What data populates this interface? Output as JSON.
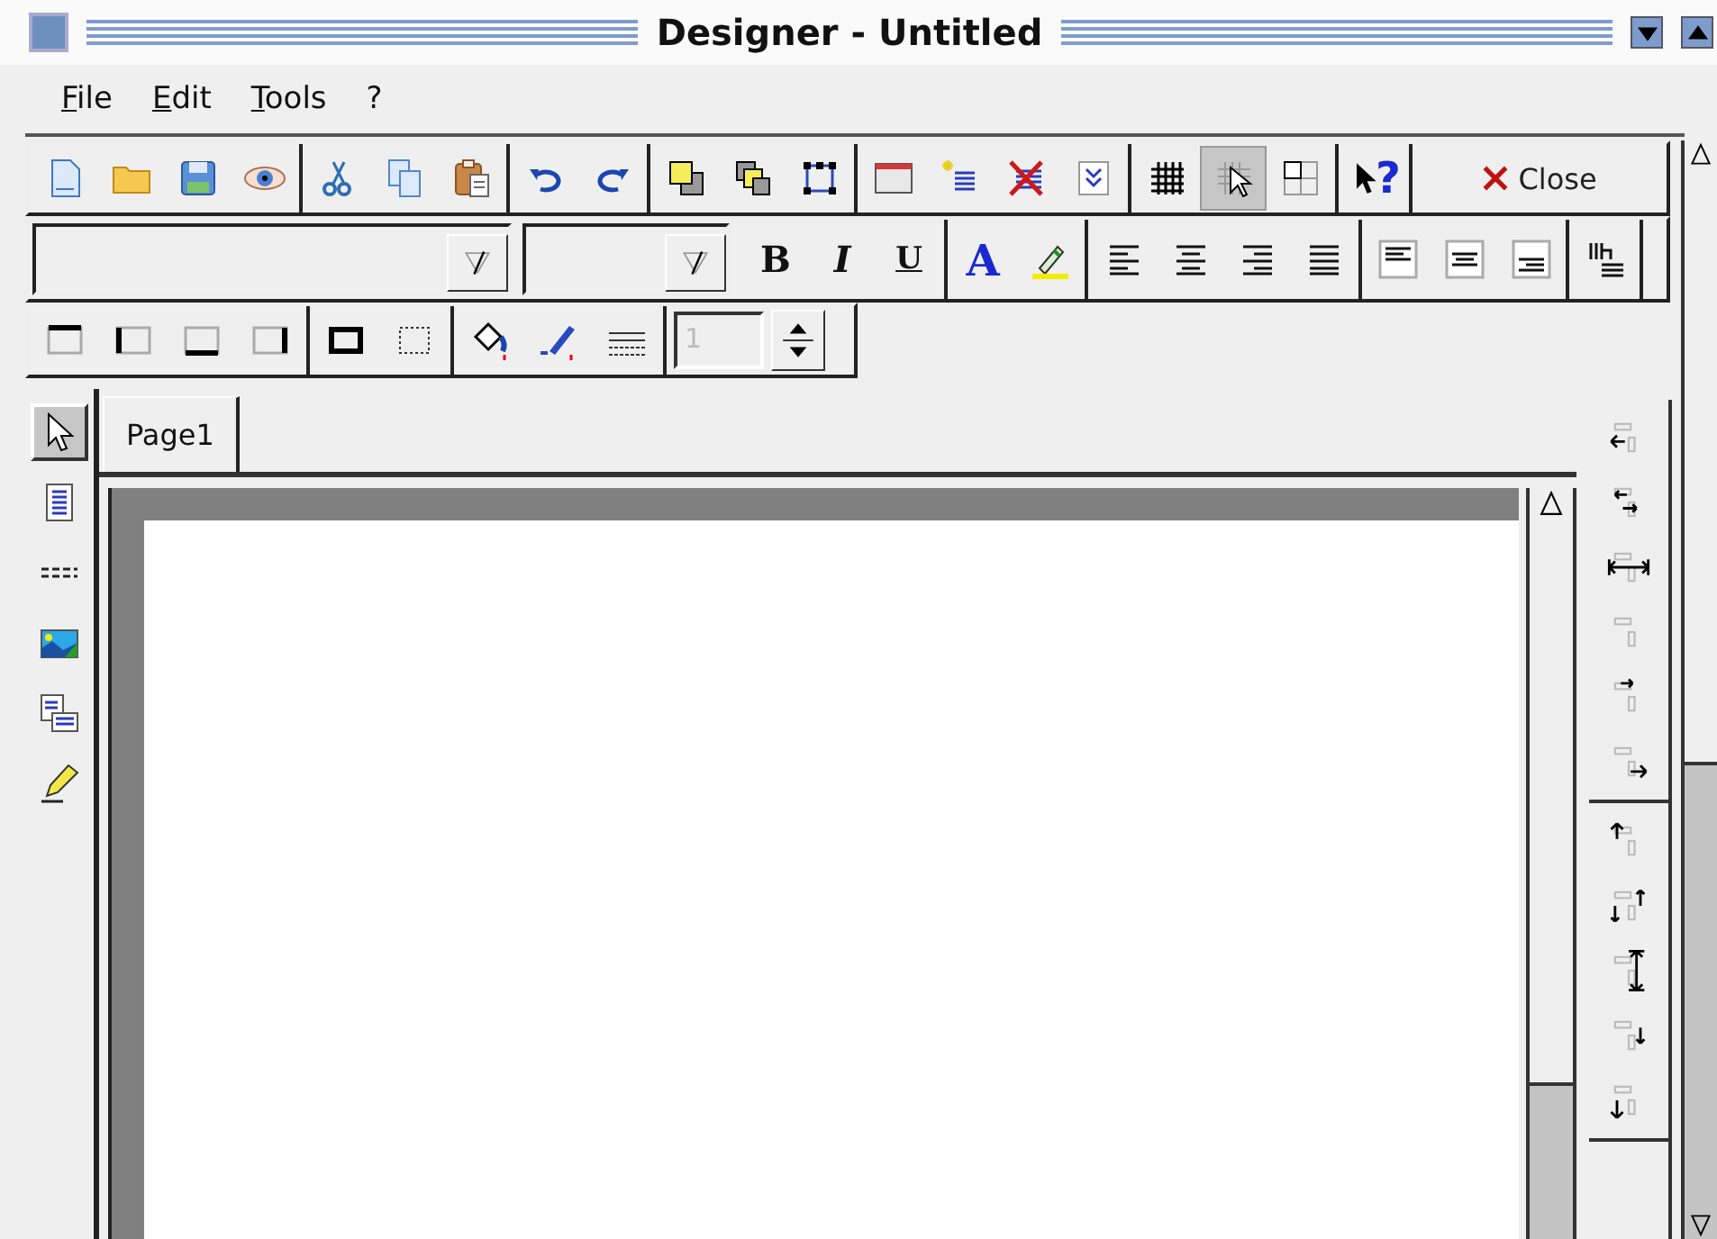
{
  "window": {
    "title": "Designer - Untitled"
  },
  "menu": [
    {
      "label": "File"
    },
    {
      "label": "Edit"
    },
    {
      "label": "Tools"
    },
    {
      "label": "?"
    }
  ],
  "toolbar_main": {
    "groups": [
      [
        {
          "kind": "new"
        },
        {
          "kind": "open"
        },
        {
          "kind": "save"
        },
        {
          "kind": "preview"
        }
      ],
      [
        {
          "kind": "cut"
        },
        {
          "kind": "copy"
        },
        {
          "kind": "paste"
        }
      ],
      [
        {
          "kind": "undo"
        },
        {
          "kind": "redo"
        }
      ],
      [
        {
          "kind": "front"
        },
        {
          "kind": "back"
        },
        {
          "kind": "frame"
        }
      ],
      [
        {
          "kind": "window"
        },
        {
          "kind": "add"
        },
        {
          "kind": "delete"
        },
        {
          "kind": "chevrons"
        }
      ],
      [
        {
          "kind": "grid",
          "pressed": false
        },
        {
          "kind": "snap",
          "pressed": true
        },
        {
          "kind": "layout",
          "pressed": false
        }
      ],
      [
        {
          "kind": "help",
          "label": "?"
        }
      ]
    ],
    "close_button": {
      "label": "Close"
    }
  },
  "toolbar_format": {
    "groups": [
      [
        {
          "kind": "bold",
          "label": "B"
        },
        {
          "kind": "italic",
          "label": "I"
        },
        {
          "kind": "underline",
          "label": "U"
        }
      ],
      [
        {
          "kind": "text-color",
          "label": "A"
        },
        {
          "kind": "highlight"
        }
      ],
      [
        {
          "kind": "align-left"
        },
        {
          "kind": "align-center"
        },
        {
          "kind": "align-right"
        },
        {
          "kind": "justify"
        }
      ],
      [
        {
          "kind": "valign-top"
        },
        {
          "kind": "valign-middle"
        },
        {
          "kind": "valign-bottom"
        }
      ],
      [
        {
          "kind": "wrap"
        }
      ]
    ]
  },
  "toolbar_border": {
    "groups": [
      [
        {
          "kind": "border-top"
        },
        {
          "kind": "border-left"
        },
        {
          "kind": "border-bottom"
        },
        {
          "kind": "border-right"
        }
      ],
      [
        {
          "kind": "border-all"
        },
        {
          "kind": "border-none"
        }
      ],
      [
        {
          "kind": "fill"
        },
        {
          "kind": "pen"
        },
        {
          "kind": "line-style"
        }
      ]
    ],
    "spin": {
      "value": "1",
      "disabled": true
    }
  },
  "tool_palette": [
    {
      "kind": "pointer",
      "selected": true
    },
    {
      "kind": "label",
      "selected": false
    },
    {
      "kind": "line",
      "selected": false
    },
    {
      "kind": "image",
      "selected": false
    },
    {
      "kind": "field",
      "selected": false
    },
    {
      "kind": "pencil",
      "selected": false
    }
  ],
  "tabs": [
    {
      "label": "Page1",
      "selected": true
    }
  ],
  "align_palette": {
    "groups": [
      [
        {
          "kind": "left"
        },
        {
          "kind": "center-h"
        },
        {
          "kind": "width"
        },
        {
          "kind": "stack-h"
        },
        {
          "kind": "right-top"
        },
        {
          "kind": "right"
        }
      ],
      [
        {
          "kind": "top"
        },
        {
          "kind": "center-v"
        },
        {
          "kind": "height"
        },
        {
          "kind": "stack-v"
        },
        {
          "kind": "bottom"
        }
      ]
    ]
  }
}
